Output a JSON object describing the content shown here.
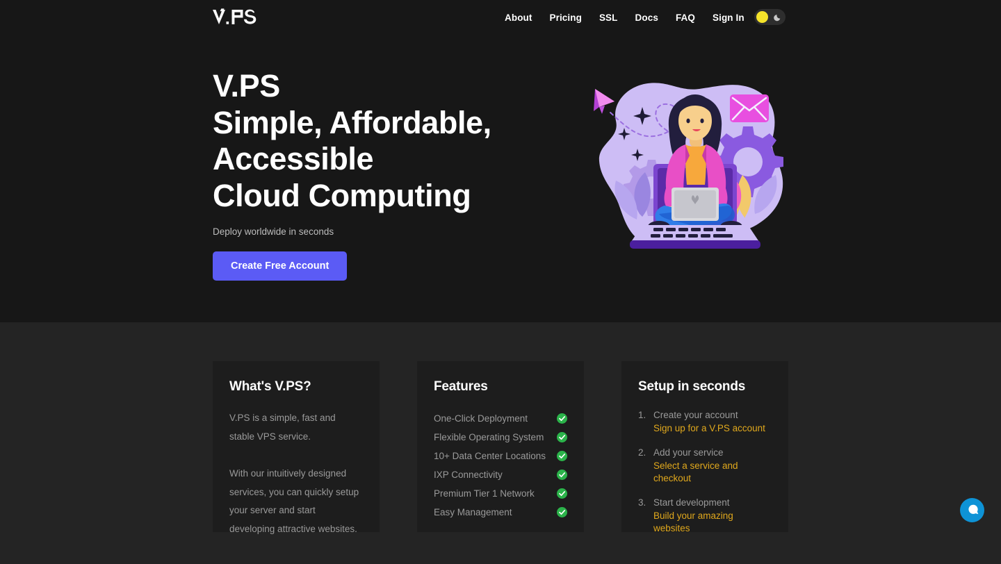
{
  "brand": {
    "logo_text": "V.PS",
    "accent_color": "#5b5bf5",
    "hero_bg": "#171717",
    "section_bg": "#242424",
    "card_bg": "#1d1d1d",
    "check_color": "#2bb34a",
    "step_link_color": "#e0a81d",
    "chat_color": "#0e93d6"
  },
  "header": {
    "nav": [
      {
        "label": "About"
      },
      {
        "label": "Pricing"
      },
      {
        "label": "SSL"
      },
      {
        "label": "Docs"
      },
      {
        "label": "FAQ"
      },
      {
        "label": "Sign In"
      }
    ],
    "theme_toggle": {
      "sun_icon": "sun-icon",
      "moon_icon": "moon-icon",
      "state": "dark"
    }
  },
  "hero": {
    "title_lines": [
      "V.PS",
      "Simple, Affordable,",
      "Accessible",
      "Cloud Computing"
    ],
    "subtitle": "Deploy worldwide in seconds",
    "cta_label": "Create Free Account",
    "illustration": "woman-on-laptop-illustration"
  },
  "cards": {
    "about": {
      "title": "What's V.PS?",
      "paragraphs": [
        "V.PS is a simple, fast and stable VPS service.",
        "With our intuitively designed services, you can quickly setup your server and start developing attractive websites."
      ]
    },
    "features": {
      "title": "Features",
      "items": [
        {
          "label": "One-Click Deployment",
          "checked": true
        },
        {
          "label": "Flexible Operating System",
          "checked": true
        },
        {
          "label": "10+ Data Center Locations",
          "checked": true
        },
        {
          "label": "IXP Connectivity",
          "checked": true
        },
        {
          "label": "Premium Tier 1 Network",
          "checked": true
        },
        {
          "label": "Easy Management",
          "checked": true
        }
      ]
    },
    "setup": {
      "title": "Setup in seconds",
      "steps": [
        {
          "num": "1.",
          "main": "Create your account",
          "sub": "Sign up for a V.PS account"
        },
        {
          "num": "2.",
          "main": "Add your service",
          "sub": "Select a service and checkout"
        },
        {
          "num": "3.",
          "main": "Start development",
          "sub": "Build your amazing websites"
        }
      ]
    }
  },
  "chat": {
    "icon": "chat-bubble-icon"
  }
}
